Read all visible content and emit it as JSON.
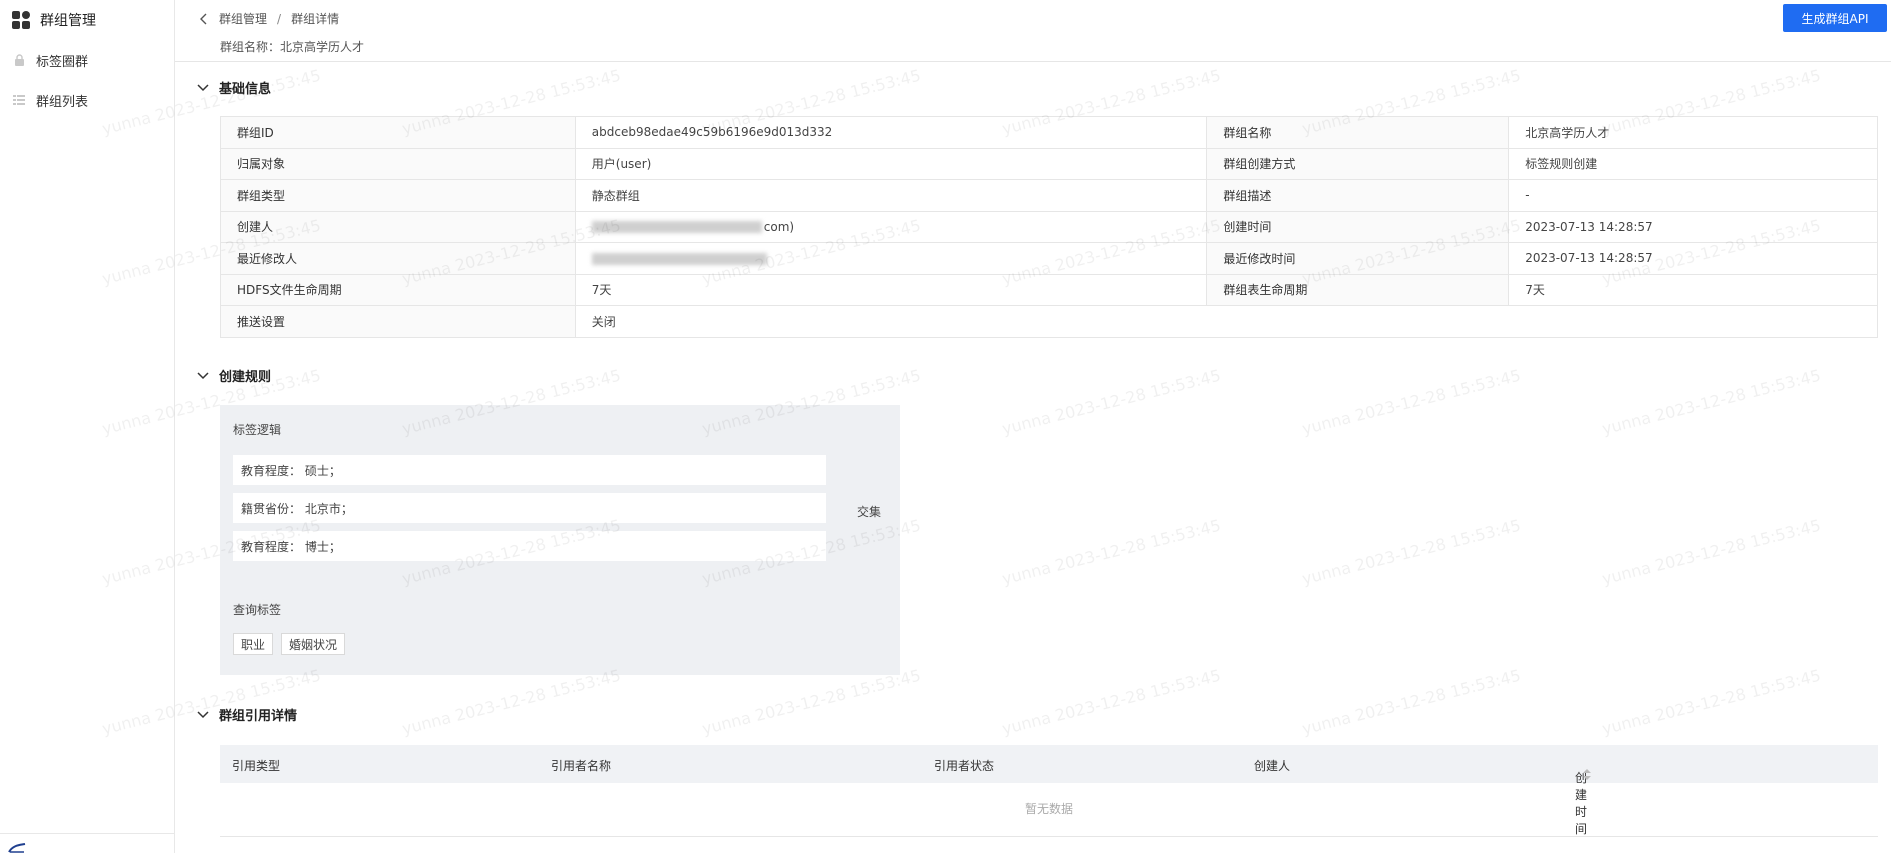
{
  "sidebar": {
    "title": "群组管理",
    "items": [
      {
        "label": "标签圈群",
        "icon": "lock-icon"
      },
      {
        "label": "群组列表",
        "icon": "list-icon"
      }
    ]
  },
  "header": {
    "breadcrumb": [
      "群组管理",
      "群组详情"
    ],
    "breadcrumb_sep": "/",
    "group_name_label": "群组名称：",
    "group_name": "北京高学历人才",
    "generate_api_button": "生成群组API"
  },
  "basic_info": {
    "title": "基础信息",
    "rows": [
      {
        "l1": "群组ID",
        "v1": "abdceb98edae49c59b6196e9d013d332",
        "l2": "群组名称",
        "v2": "北京高学历人才"
      },
      {
        "l1": "归属对象",
        "v1": "用户(user)",
        "l2": "群组创建方式",
        "v2": "标签规则创建"
      },
      {
        "l1": "群组类型",
        "v1": "静态群组",
        "l2": "群组描述",
        "v2": "-"
      },
      {
        "l1": "创建人",
        "v1": "com)",
        "l2": "创建时间",
        "v2": "2023-07-13 14:28:57"
      },
      {
        "l1": "最近修改人",
        "v1": "",
        "l2": "最近修改时间",
        "v2": "2023-07-13 14:28:57"
      },
      {
        "l1": "HDFS文件生命周期",
        "v1": "7天",
        "l2": "群组表生命周期",
        "v2": "7天"
      },
      {
        "l1": "推送设置",
        "v1": "关闭"
      }
    ]
  },
  "rules": {
    "title": "创建规则",
    "logic_label": "标签逻辑",
    "conditions": [
      "教育程度：  硕士；",
      "籍贯省份：  北京市；",
      "教育程度：  博士；"
    ],
    "operator": "交集",
    "query_label": "查询标签",
    "query_tags": [
      "职业",
      "婚姻状况"
    ]
  },
  "references": {
    "title": "群组引用详情",
    "columns": [
      "引用类型",
      "引用者名称",
      "引用者状态",
      "创建人",
      "创建时间"
    ],
    "empty_text": "暂无数据"
  },
  "watermark": "yunna 2023-12-28 15:53:45",
  "colors": {
    "primary": "#1f6cf2",
    "header_bg": "#f0f2f5",
    "rule_bg": "#eef0f3"
  }
}
